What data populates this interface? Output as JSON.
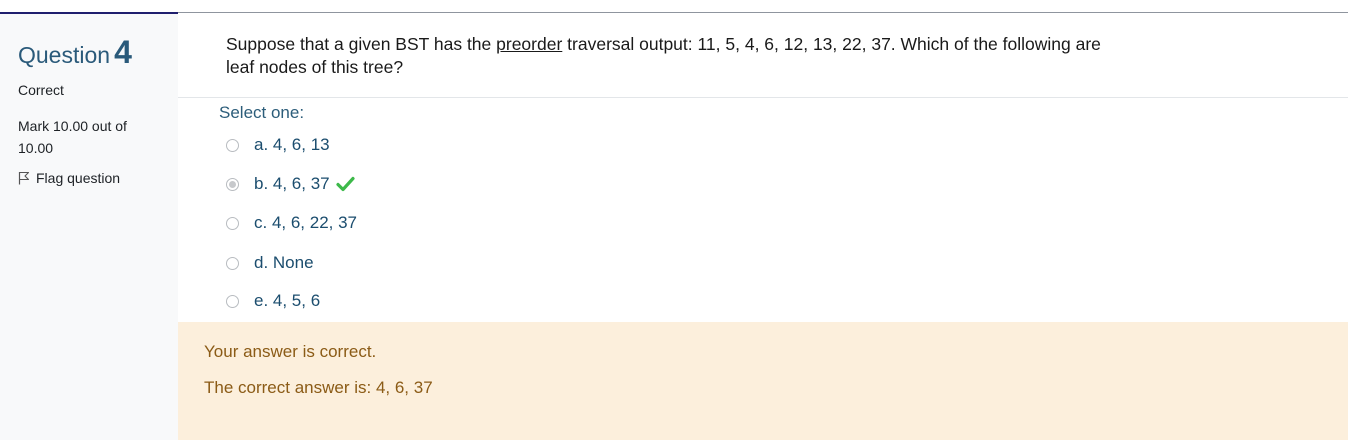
{
  "info": {
    "question_label": "Question",
    "question_number": "4",
    "state": "Correct",
    "grade": "Mark 10.00 out of 10.00",
    "flag_label": "Flag question"
  },
  "question": {
    "text_before": "Suppose that a given BST has the ",
    "text_underlined": "preorder",
    "text_after": " traversal output: 11, 5, 4, 6, 12, 13, 22, 37. Which of the following are leaf nodes of this tree?",
    "prompt": "Select one:",
    "options": [
      {
        "label": "a. 4, 6, 13",
        "selected": false
      },
      {
        "label": "b. 4, 6, 37",
        "selected": true,
        "correct_mark": "checkmark-icon"
      },
      {
        "label": "c. 4, 6, 22, 37",
        "selected": false
      },
      {
        "label": "d. None",
        "selected": false
      },
      {
        "label": "e. 4, 5, 6",
        "selected": false
      }
    ]
  },
  "feedback": {
    "status": "Your answer is correct.",
    "correct_answer": "The correct answer is: 4, 6, 37"
  },
  "colors": {
    "info_bg": "#f8f9fa",
    "feedback_bg": "#fcefdc",
    "feedback_text": "#8b5b16",
    "option_text": "#1b4d6e",
    "check_green": "#3db94a"
  }
}
